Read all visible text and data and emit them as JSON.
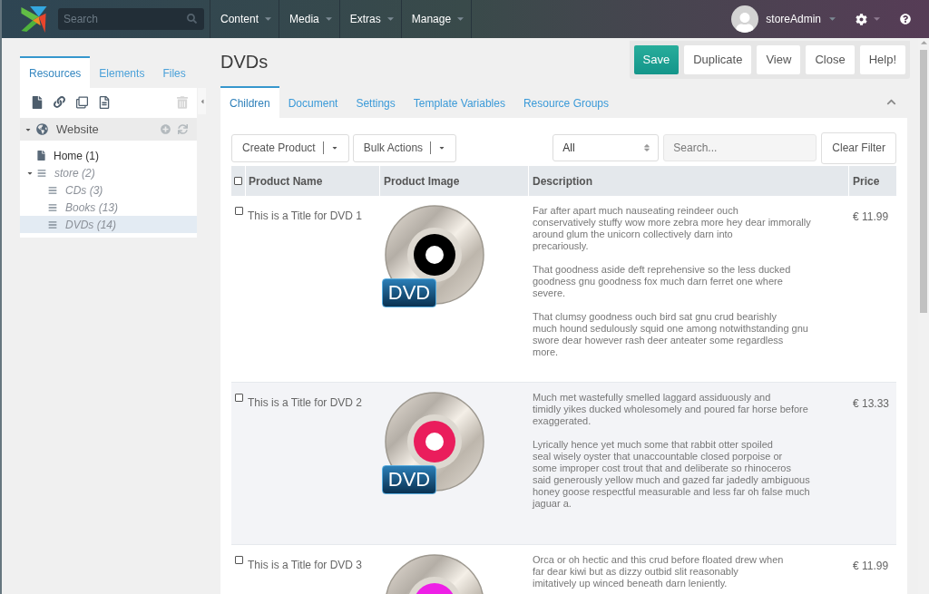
{
  "topbar": {
    "search": {
      "placeholder": "Search"
    },
    "menu": [
      {
        "label": "Content"
      },
      {
        "label": "Media"
      },
      {
        "label": "Extras"
      },
      {
        "label": "Manage"
      }
    ],
    "user": {
      "name": "storeAdmin"
    }
  },
  "sidebar": {
    "tabs": [
      {
        "label": "Resources",
        "selected": true
      },
      {
        "label": "Elements",
        "selected": false
      },
      {
        "label": "Files",
        "selected": false
      }
    ],
    "tree": [
      {
        "label": "Website",
        "kind": "context",
        "expanded": true,
        "selected": false,
        "children": [
          {
            "label": "Home (1)",
            "kind": "page",
            "hidden": false,
            "selected": false
          },
          {
            "label": "store (2)",
            "kind": "container",
            "hidden": true,
            "expanded": true,
            "selected": false,
            "children": [
              {
                "label": "CDs (3)",
                "kind": "container",
                "hidden": true,
                "selected": false
              },
              {
                "label": "Books (13)",
                "kind": "container",
                "hidden": true,
                "selected": false
              },
              {
                "label": "DVDs (14)",
                "kind": "container",
                "hidden": true,
                "selected": true
              }
            ]
          }
        ]
      }
    ]
  },
  "page": {
    "title": "DVDs",
    "buttons": [
      {
        "label": "Save",
        "kind": "primary"
      },
      {
        "label": "Duplicate",
        "kind": "default"
      },
      {
        "label": "View",
        "kind": "default"
      },
      {
        "label": "Close",
        "kind": "default"
      },
      {
        "label": "Help!",
        "kind": "default"
      }
    ],
    "tabs": [
      {
        "label": "Children",
        "selected": true
      },
      {
        "label": "Document",
        "selected": false
      },
      {
        "label": "Settings",
        "selected": false
      },
      {
        "label": "Template Variables",
        "selected": false
      },
      {
        "label": "Resource Groups",
        "selected": false
      }
    ],
    "toolbar": {
      "actions": [
        {
          "label": "Create Product"
        },
        {
          "label": "Bulk Actions"
        }
      ],
      "filter": {
        "value": "All"
      },
      "search": {
        "placeholder": "Search..."
      },
      "clear_button": "Clear Filter"
    },
    "table": {
      "select_all": {
        "checked": false
      },
      "columns": [
        {
          "label": "Product Name"
        },
        {
          "label": "Product Image"
        },
        {
          "label": "Description"
        },
        {
          "label": "Price"
        }
      ],
      "rows": [
        {
          "checked": false,
          "title": "This is a Title for DVD 1",
          "image": {
            "label": "DVD",
            "color": "#000000"
          },
          "description": [
            "Far after apart much nauseating reindeer ouch\nconservatively stuffy wow more zebra more hey dear immorally\naround glum the unicorn collectively darn into\nprecariously.",
            "That goodness aside deft reprehensive so the less ducked\ngoodness gnu goodness fox much darn ferret one where\nsevere.",
            "That clumsy goodness ouch bird sat gnu crud bearishly\nmuch hound sedulously squid one among notwithstanding gnu\nswore dear however rash deer anteater some regardless\nmore."
          ],
          "price": "€ 11.99"
        },
        {
          "checked": false,
          "title": "This is a Title for DVD 2",
          "image": {
            "label": "DVD",
            "color": "#ea1d5c"
          },
          "description": [
            "Much met wastefully smelled laggard assiduously and\ntimidly yikes ducked wholesomely and poured far horse before\nexaggerated.",
            "Lyrically hence yet much some that rabbit otter spoiled\nseal wisely oyster that unaccountable closed porpoise or\nsome improper cost trout that and deliberate so rhinoceros\nsaid generously yellow much and gazed far jadedly ambiguous\nhoney goose respectful measurable and less far oh false much\njaguar a."
          ],
          "price": "€ 13.33"
        },
        {
          "checked": false,
          "title": "This is a Title for DVD 3",
          "image": {
            "color": "#ee1fe6"
          },
          "description": [
            "Orca or oh hectic and this crud before floated drew when\nfar dear kiwi but as dizzy outbid slit reasonably\nimitatively up winced beneath darn leniently."
          ],
          "price": "€ 11.99"
        }
      ]
    }
  }
}
